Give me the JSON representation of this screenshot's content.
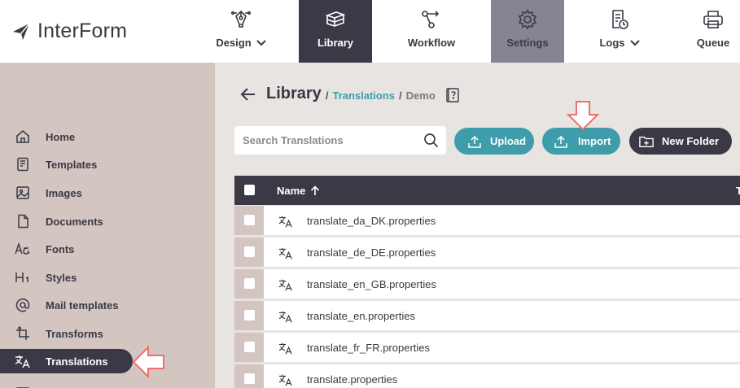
{
  "app": {
    "logo_text": "InterForm"
  },
  "topnav": {
    "items": [
      {
        "label": "Design",
        "has_dropdown": true
      },
      {
        "label": "Library",
        "active": true
      },
      {
        "label": "Workflow"
      },
      {
        "label": "Settings",
        "highlighted": true
      },
      {
        "label": "Logs",
        "has_dropdown": true
      },
      {
        "label": "Queue"
      }
    ]
  },
  "sidebar": {
    "items": [
      {
        "label": "Home",
        "icon": "home-icon"
      },
      {
        "label": "Templates",
        "icon": "templates-icon"
      },
      {
        "label": "Images",
        "icon": "image-icon"
      },
      {
        "label": "Documents",
        "icon": "document-icon"
      },
      {
        "label": "Fonts",
        "icon": "fonts-icon"
      },
      {
        "label": "Styles",
        "icon": "heading-icon"
      },
      {
        "label": "Mail templates",
        "icon": "at-sign-icon"
      },
      {
        "label": "Transforms",
        "icon": "transform-icon"
      },
      {
        "label": "Translations",
        "icon": "translate-icon",
        "active": true
      }
    ]
  },
  "breadcrumb": {
    "title": "Library",
    "separator": "/",
    "link": "Translations",
    "current": "Demo"
  },
  "search": {
    "placeholder": "Search Translations"
  },
  "toolbar": {
    "upload_label": "Upload",
    "import_label": "Import",
    "new_folder_label": "New Folder"
  },
  "table": {
    "columns": {
      "name": "Name",
      "type_partial": "T"
    },
    "rows": [
      {
        "name": "translate_da_DK.properties"
      },
      {
        "name": "translate_de_DE.properties"
      },
      {
        "name": "translate_en_GB.properties"
      },
      {
        "name": "translate_en.properties"
      },
      {
        "name": "translate_fr_FR.properties"
      },
      {
        "name": "translate.properties"
      }
    ]
  },
  "colors": {
    "dark": "#3c3947",
    "teal": "#3e9cab",
    "sidebar_bg": "#d3c6c0",
    "main_bg": "#e8e4e1",
    "settings_bg": "#858592",
    "annotation_arrow": "#f26d6d"
  }
}
